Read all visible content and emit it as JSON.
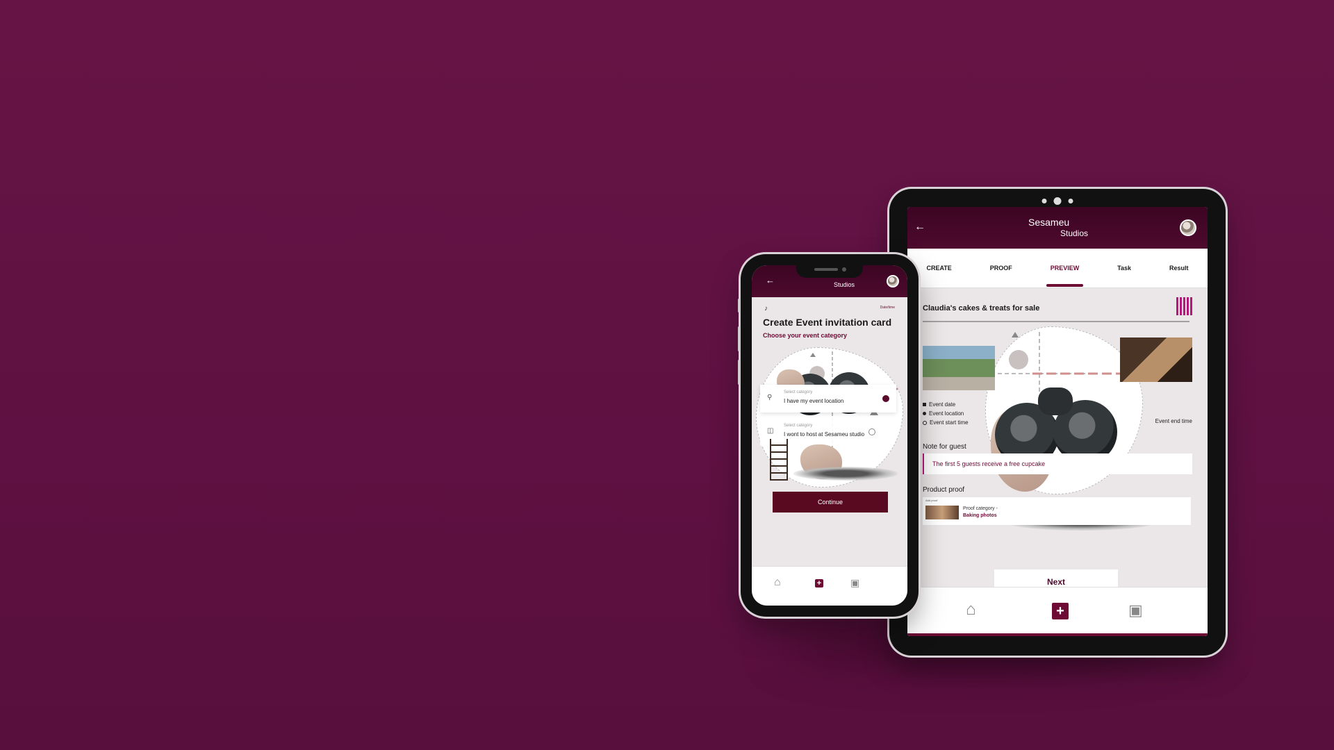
{
  "tablet": {
    "brand_line1": "Sesameu",
    "brand_line2": "Studios",
    "tabs": [
      {
        "label": "CREATE"
      },
      {
        "label": "PROOF"
      },
      {
        "label": "PREVIEW"
      },
      {
        "label": "Task"
      },
      {
        "label": "Result"
      }
    ],
    "active_tab": "PREVIEW",
    "card_title": "Claudia's cakes & treats for sale",
    "meta": [
      "Event date",
      "Event location",
      "Event start time"
    ],
    "end_time": "Event end time",
    "note_label": "Note for guest",
    "note_text": "The first 5 guests receive a free cupcake",
    "proof_label": "Product proof",
    "proof_small": "Add proof",
    "proof_category": "Proof category -",
    "proof_value": "Baking photos",
    "next_label": "Next"
  },
  "phone": {
    "brand_line1": "Sesameu",
    "brand_line2": "Studios",
    "top_right": "Date/time",
    "title": "Create Event invitation card",
    "subtitle": "Choose your event category",
    "options": [
      {
        "small": "Select category",
        "text": "I have my event location",
        "selected": true
      },
      {
        "small": "Select category",
        "text": "I wont to host at Sesameu studio",
        "selected": false
      }
    ],
    "continue_label": "Continue"
  },
  "colors": {
    "background": "#5e1142",
    "accent": "#6d0b34",
    "barcode": "#b5187a"
  },
  "icons": [
    "back-arrow-icon",
    "avatar",
    "barcode-icon",
    "bell-icon",
    "home-icon",
    "plus-icon",
    "gallery-icon",
    "location-pin-icon",
    "bag-icon",
    "calendar-icon",
    "clock-icon"
  ]
}
